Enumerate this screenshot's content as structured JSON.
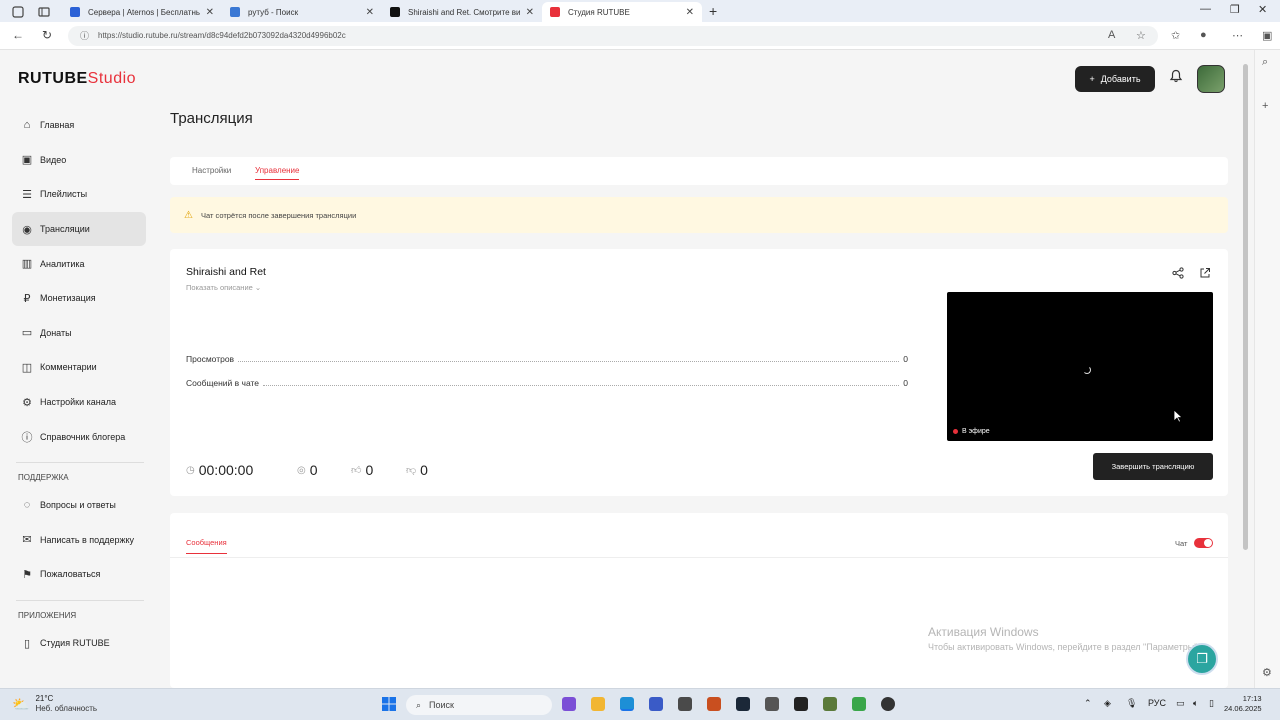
{
  "browser": {
    "tabs": [
      {
        "title": "Сервера | Aternos | Бесплатный",
        "color": "#2b61d6",
        "active": false
      },
      {
        "title": "рутуб - Поиск",
        "color": "#3a78d4",
        "active": false
      },
      {
        "title": "Shiraishi and Ret. Смотрите виде",
        "color": "#111111",
        "active": false
      },
      {
        "title": "Студия RUTUBE",
        "color": "#e8313b",
        "active": true
      }
    ],
    "url": "https://studio.rutube.ru/stream/d8c94defd2b073092da4320d4996b02c"
  },
  "logo": {
    "main": "RUTUBE",
    "sub": "Studio"
  },
  "header": {
    "add_label": "Добавить"
  },
  "sidebar": {
    "items": [
      {
        "label": "Главная",
        "icon": "home-icon",
        "glyph": "⌂"
      },
      {
        "label": "Видео",
        "icon": "video-icon",
        "glyph": "▣"
      },
      {
        "label": "Плейлисты",
        "icon": "playlist-icon",
        "glyph": "☰"
      },
      {
        "label": "Трансляции",
        "icon": "broadcast-icon",
        "glyph": "◉"
      },
      {
        "label": "Аналитика",
        "icon": "analytics-icon",
        "glyph": "▥"
      },
      {
        "label": "Монетизация",
        "icon": "monetization-icon",
        "glyph": "₽"
      },
      {
        "label": "Донаты",
        "icon": "donate-icon",
        "glyph": "▭"
      },
      {
        "label": "Комментарии",
        "icon": "comments-icon",
        "glyph": "◫"
      },
      {
        "label": "Настройки канала",
        "icon": "settings-icon",
        "glyph": "⚙"
      },
      {
        "label": "Справочник блогера",
        "icon": "info-icon",
        "glyph": "ⓘ"
      }
    ],
    "support_title": "ПОДДЕРЖКА",
    "support_items": [
      {
        "label": "Вопросы и ответы",
        "icon": "faq-icon",
        "glyph": "◌"
      },
      {
        "label": "Написать в поддержку",
        "icon": "mail-icon",
        "glyph": "✉"
      },
      {
        "label": "Пожаловаться",
        "icon": "flag-icon",
        "glyph": "⚑"
      }
    ],
    "apps_title": "ПРИЛОЖЕНИЯ",
    "apps_items": [
      {
        "label": "Студия RUTUBE",
        "icon": "app-icon",
        "glyph": "▯"
      }
    ]
  },
  "page": {
    "title": "Трансляция",
    "tabs": [
      "Настройки",
      "Управление"
    ],
    "active_tab": "Управление",
    "warning": "Чат сотрётся после завершения трансляции"
  },
  "stream": {
    "title": "Shiraishi and Ret",
    "show_description": "Показать описание",
    "stats": [
      {
        "label": "Просмотров",
        "value": "0"
      },
      {
        "label": "Сообщений в чате",
        "value": "0"
      }
    ],
    "on_air": "В эфире",
    "end_button": "Завершить трансляцию",
    "duration": "00:00:00",
    "viewers": "0",
    "likes": "0",
    "dislikes": "0"
  },
  "messages": {
    "tab": "Сообщения",
    "chat_label": "Чат",
    "chat_enabled": true
  },
  "watermark": {
    "line1": "Активация Windows",
    "line2": "Чтобы активировать Windows, перейдите в раздел \"Параметры\"."
  },
  "taskbar": {
    "temp": "21°C",
    "weather": "Неб. облачность",
    "search": "Поиск",
    "lang": "РУС",
    "time": "17:13",
    "date": "24.06.2025"
  },
  "colors": {
    "accent": "#e8313b",
    "dark": "#222222"
  }
}
